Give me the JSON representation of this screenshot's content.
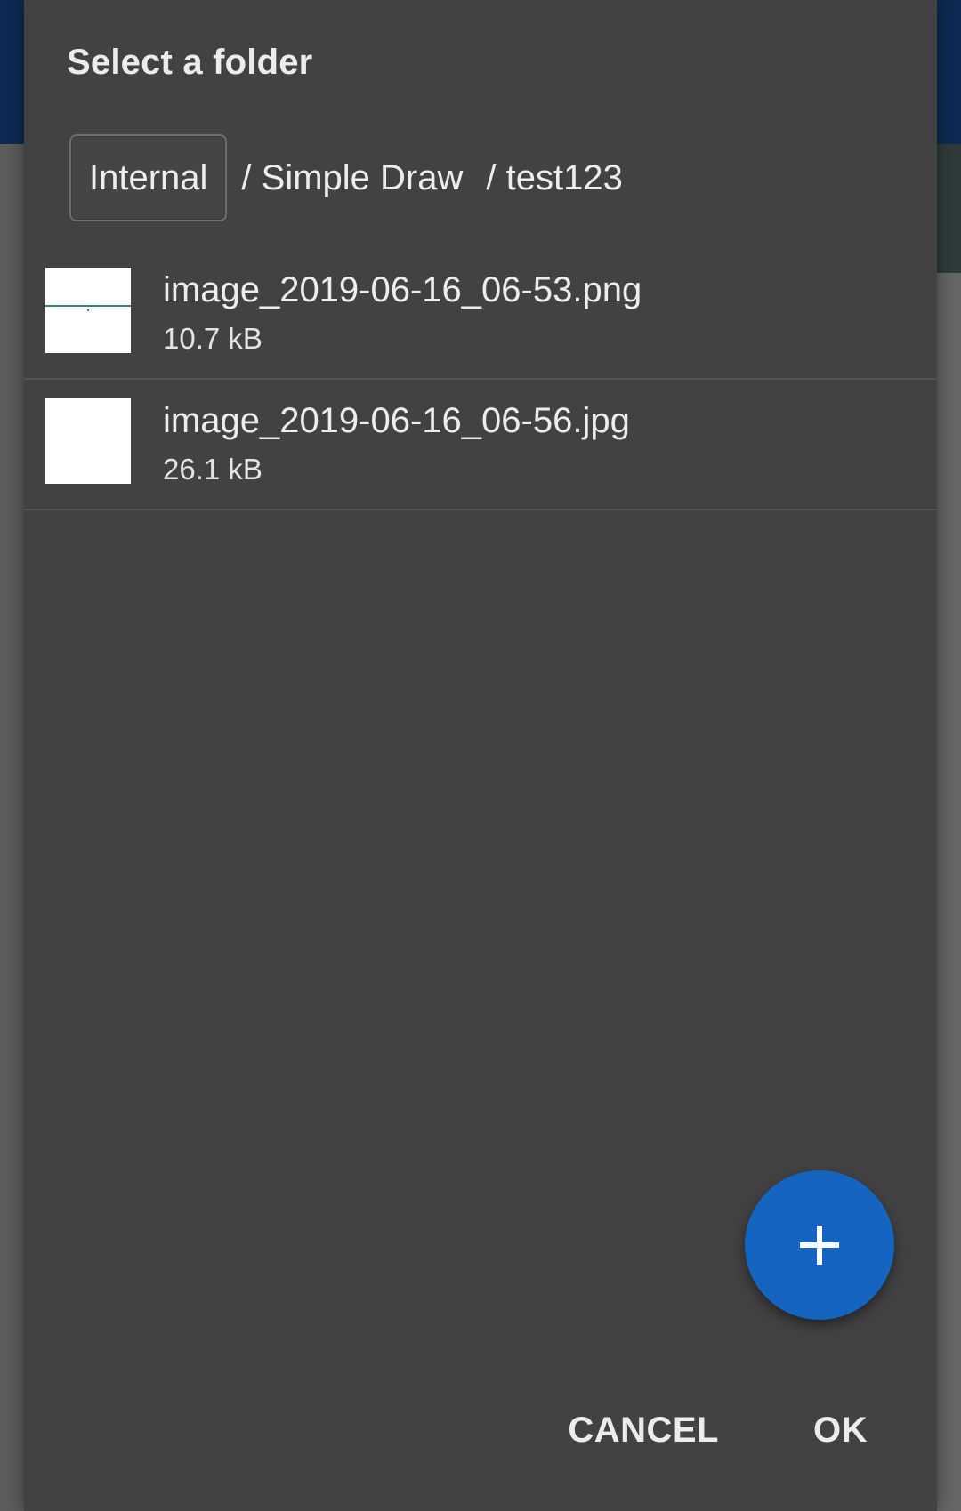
{
  "colors": {
    "dialog_background": "#424242",
    "accent": "#1565c0",
    "text": "#ececec"
  },
  "dialog": {
    "title": "Select a folder"
  },
  "breadcrumb": {
    "root": "Internal",
    "items": [
      "/ Simple Draw",
      "/ test123"
    ]
  },
  "files": [
    {
      "name": "image_2019-06-16_06-53.png",
      "size": "10.7 kB",
      "thumbnail": "image-thumbnail-with-stroke"
    },
    {
      "name": "image_2019-06-16_06-56.jpg",
      "size": "26.1 kB",
      "thumbnail": "image-thumbnail-blank"
    }
  ],
  "fab": {
    "icon": "plus-icon"
  },
  "actions": {
    "cancel_label": "CANCEL",
    "ok_label": "OK"
  }
}
